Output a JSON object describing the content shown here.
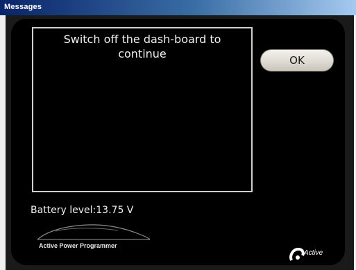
{
  "window": {
    "title": "Messages"
  },
  "message": {
    "text": "Switch off the dash-board to continue"
  },
  "ok_button": {
    "label": "OK"
  },
  "battery": {
    "text": "Battery level:13.75 V"
  },
  "product_logo": {
    "text": "Active Power Programmer"
  },
  "brand_logo": {
    "text": "Active",
    "icon": "active-logo-icon"
  },
  "colors": {
    "titlebar": "#0a246a",
    "panel_background": "#000000",
    "text": "#f2f2f2",
    "button_face": "#e0ddd4"
  }
}
